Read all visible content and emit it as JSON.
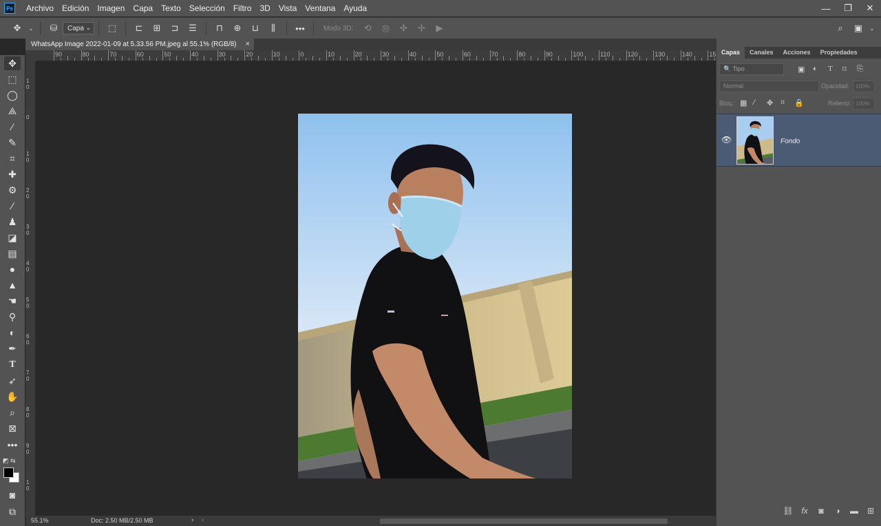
{
  "app": {
    "logo": "Ps",
    "menu": [
      "Archivo",
      "Edición",
      "Imagen",
      "Capa",
      "Texto",
      "Selección",
      "Filtro",
      "3D",
      "Vista",
      "Ventana",
      "Ayuda"
    ],
    "window_controls": [
      "—",
      "❐",
      "✕"
    ]
  },
  "options_bar": {
    "move_icon": "move-icon",
    "auto_select_value": "Capa",
    "mode3d_label": "Modo 3D:",
    "more_label": "•••"
  },
  "document": {
    "tab_title": "WhatsApp Image 2022-01-09 at 5.33.56 PM.jpeg al 55.1% (RGB/8)",
    "close_label": "×"
  },
  "rulers": {
    "top_labels": [
      "90",
      "80",
      "70",
      "60",
      "50",
      "40",
      "30",
      "20",
      "10",
      "0",
      "10",
      "20",
      "30",
      "40",
      "50",
      "60",
      "70",
      "80",
      "90",
      "100",
      "110",
      "120",
      "130",
      "140",
      "15"
    ],
    "left_labels": [
      "1\n0",
      "0",
      "1\n0",
      "2\n0",
      "3\n0",
      "4\n0",
      "5\n0",
      "6\n0",
      "7\n0",
      "8\n0",
      "9\n0",
      "1\n0"
    ]
  },
  "status": {
    "zoom": "55.1%",
    "doc_info": "Doc: 2.50 MB/2.50 MB",
    "arrow": "›",
    "arrow_left": "‹"
  },
  "panel": {
    "tabs": [
      "Capas",
      "Canales",
      "Acciones",
      "Propiedades"
    ],
    "filter_placeholder": "🔍 Tipo",
    "blend_mode": "Normal",
    "opacity_label": "Opacidad:",
    "opacity_value": "100%",
    "lock_label": "Bloq.:",
    "fill_label": "Relleno:",
    "fill_value": "100%",
    "layer_name": "Fondo"
  },
  "colors": {
    "foreground": "#000000",
    "background": "#ffffff",
    "selected_layer": "#4b5b73"
  }
}
